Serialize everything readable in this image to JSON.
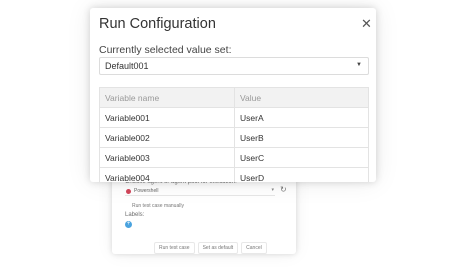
{
  "background_dialog": {
    "agent_label": "Choose agent or agent pool for execution:",
    "agent_value": "Powershell",
    "run_manually_label": "Run test case manually",
    "labels_label": "Labels:",
    "add_label_icon": "plus-icon",
    "buttons": {
      "run": "Run test case",
      "set_default": "Set as default",
      "cancel": "Cancel"
    }
  },
  "dialog": {
    "title": "Run Configuration",
    "close_icon": "close-icon",
    "value_set_label": "Currently selected value set:",
    "value_set_selected": "Default001",
    "table": {
      "headers": [
        "Variable name",
        "Value"
      ],
      "rows": [
        [
          "Variable001",
          "UserA"
        ],
        [
          "Variable002",
          "UserB"
        ],
        [
          "Variable003",
          "UserC"
        ],
        [
          "Variable004",
          "UserD"
        ]
      ]
    }
  },
  "colors": {
    "agent_dot": "#d2465a",
    "add_label": "#4aa3df",
    "header_bg": "#f2f2f2"
  }
}
